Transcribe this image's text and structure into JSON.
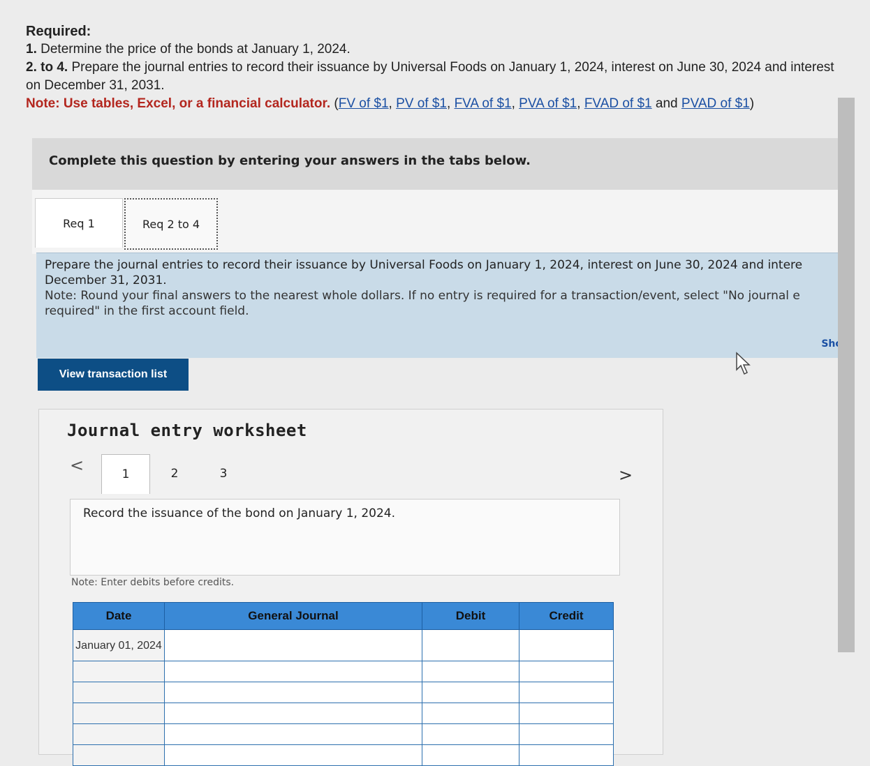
{
  "header": {
    "required_title": "Required:",
    "req1_num": "1.",
    "req1_text": "Determine the price of the bonds at January 1, 2024.",
    "req2_num": "2. to 4.",
    "req2_text": "Prepare the journal entries to record their issuance by Universal Foods on January 1, 2024, interest on June 30, 2024 and interest on December 31, 2031.",
    "note_text": "Note: Use tables, Excel, or a financial calculator.",
    "links": [
      "FV of $1",
      "PV of $1",
      "FVA of $1",
      "PVA of $1",
      "FVAD of $1",
      "PVAD of $1"
    ],
    "and_word": "and"
  },
  "banner": {
    "text": "Complete this question by entering your answers in the tabs below."
  },
  "tabs": [
    {
      "label": "Req 1"
    },
    {
      "label": "Req 2 to 4"
    }
  ],
  "instructions": {
    "main": "Prepare the journal entries to record their issuance by Universal Foods on January 1, 2024, interest on June 30, 2024 and intere December 31, 2031.",
    "note": "Note: Round your final answers to the nearest whole dollars. If no entry is required for a transaction/event, select \"No journal e required\" in the first account field.",
    "show_link": "Sho"
  },
  "view_button": "View transaction list",
  "worksheet": {
    "title": "Journal entry worksheet",
    "pages": [
      "1",
      "2",
      "3"
    ],
    "instruction": "Record the issuance of the bond on January 1, 2024.",
    "note": "Note: Enter debits before credits.",
    "columns": [
      "Date",
      "General Journal",
      "Debit",
      "Credit"
    ],
    "first_date": "January 01, 2024"
  },
  "colors": {
    "accent": "#0d4e85",
    "table_header": "#3a89d6",
    "note_red": "#b3261e"
  }
}
